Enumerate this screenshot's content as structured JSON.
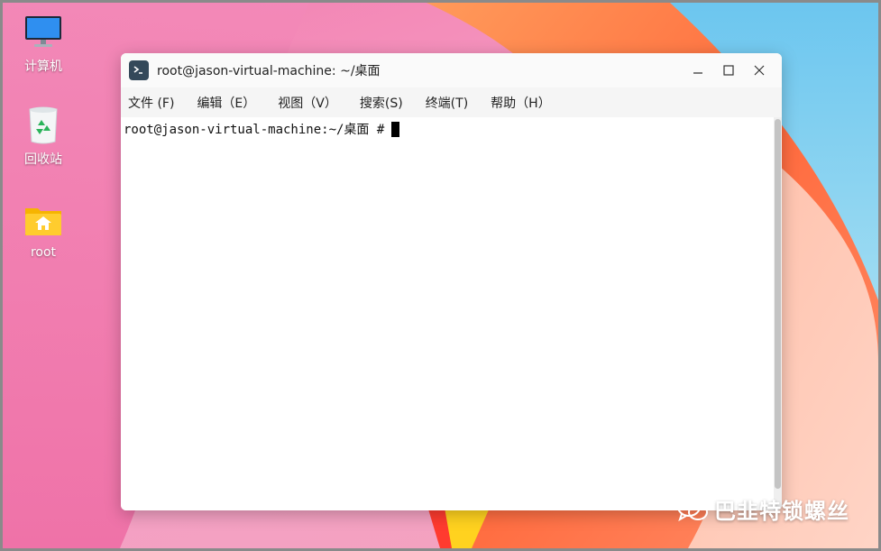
{
  "desktop": {
    "icons": [
      {
        "label": "计算机",
        "icon": "computer-icon"
      },
      {
        "label": "回收站",
        "icon": "trash-icon"
      },
      {
        "label": "root",
        "icon": "home-folder-icon"
      }
    ],
    "colors": {
      "wallpaper_pink": "#f27fb0",
      "wallpaper_orange": "#ff6a3d",
      "wallpaper_blue": "#6cc6ef"
    }
  },
  "window": {
    "title": "root@jason-virtual-machine: ~/桌面",
    "app_icon": "terminal-icon",
    "controls": {
      "minimize": "minimize-icon",
      "maximize": "maximize-icon",
      "close": "close-icon"
    },
    "menu": [
      {
        "label": "文件 (F)"
      },
      {
        "label": "编辑（E）"
      },
      {
        "label": "视图（V）"
      },
      {
        "label": "搜索(S)"
      },
      {
        "label": "终端(T)"
      },
      {
        "label": "帮助（H）"
      }
    ],
    "terminal": {
      "prompt": "root@jason-virtual-machine:~/桌面 #"
    }
  },
  "watermark": {
    "text": "巴韭特锁螺丝",
    "icon": "wechat-icon"
  }
}
